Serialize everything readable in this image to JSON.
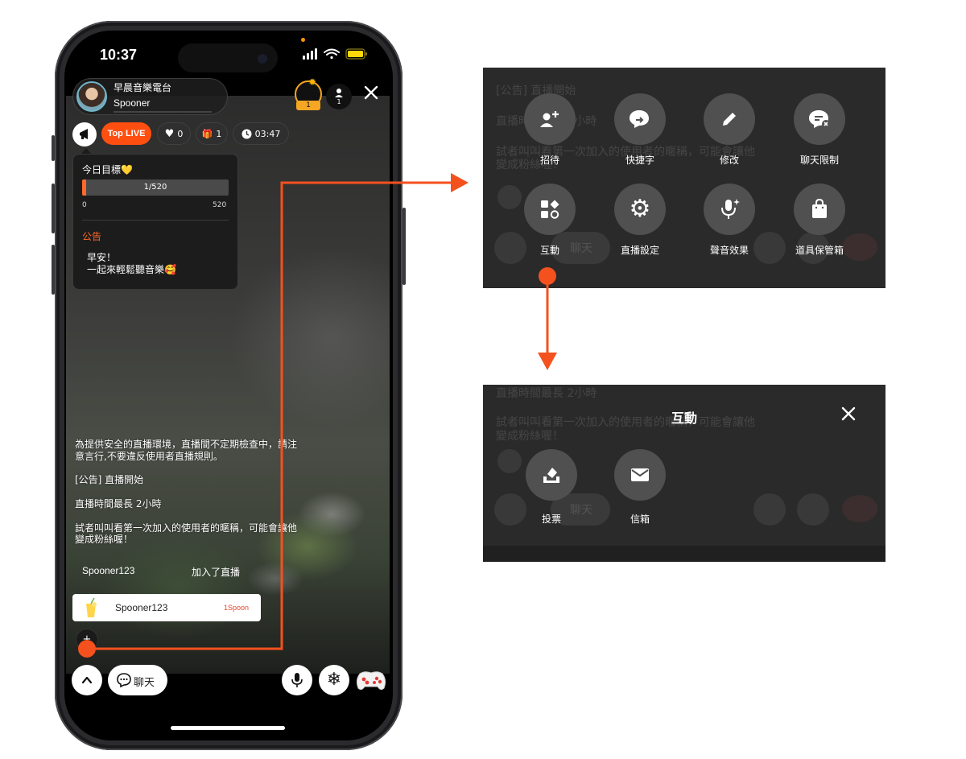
{
  "status_bar": {
    "time": "10:37"
  },
  "host": {
    "title": "早晨音樂電台",
    "name": "Spooner"
  },
  "rank": {
    "number": "1"
  },
  "listeners": {
    "count": "1"
  },
  "chips": {
    "top_live": "Top LIVE",
    "likes": "0",
    "gifts": "1",
    "timer": "03:47"
  },
  "goal_popup": {
    "title": "今日目標💛",
    "progress_text": "1/520",
    "progress_fraction": 0.0019,
    "min": "0",
    "max": "520",
    "notice_label": "公告",
    "notice_lines": [
      "早安！",
      "一起來輕鬆聽音樂🥰"
    ]
  },
  "chat": {
    "messages": [
      "為提供安全的直播環境，直播間不定期檢查中，請注",
      "意言行,不要違反使用者直播規則。",
      "[公告] 直播開始",
      "直播時間最長  2小時",
      "試者叫叫看第一次加入的使用者的暱稱，可能會讓他",
      "變成粉絲喔！"
    ],
    "join_user": "Spooner123",
    "join_text": "加入了直播",
    "gift_user": "Spooner123",
    "gift_amount": "1Spoon"
  },
  "bottom_bar": {
    "chat_label": "聊天",
    "plus": "+"
  },
  "menu_panel": {
    "items": [
      {
        "label": "招待",
        "icon": "add-user-icon"
      },
      {
        "label": "快捷字",
        "icon": "quick-reply-icon"
      },
      {
        "label": "修改",
        "icon": "pencil-icon"
      },
      {
        "label": "聊天限制",
        "icon": "chat-restrict-icon"
      },
      {
        "label": "互動",
        "icon": "interaction-icon"
      },
      {
        "label": "直播設定",
        "icon": "gear-icon"
      },
      {
        "label": "聲音效果",
        "icon": "voice-effect-icon"
      },
      {
        "label": "道具保管箱",
        "icon": "bag-icon"
      }
    ],
    "ghost_texts": [
      "[公告] 直播開始",
      "直播時間最長  2小時",
      "試者叫叫看第一次加入的使用者的暱稱，可能會讓他",
      "變成粉絲喔！"
    ],
    "ghost_chat": "聊天"
  },
  "interaction_panel": {
    "title": "互動",
    "items": [
      {
        "label": "投票",
        "icon": "vote-icon"
      },
      {
        "label": "信箱",
        "icon": "mail-icon"
      }
    ],
    "ghost_texts": [
      "直播時間最長  2小時",
      "試者叫叫看第一次加入的使用者的暱稱，可能會讓他",
      "變成粉絲喔！"
    ],
    "ghost_chat": "聊天"
  },
  "colors": {
    "accent": "#ff4f10",
    "callout": "#f4511e",
    "notice": "#ff6a2a"
  }
}
